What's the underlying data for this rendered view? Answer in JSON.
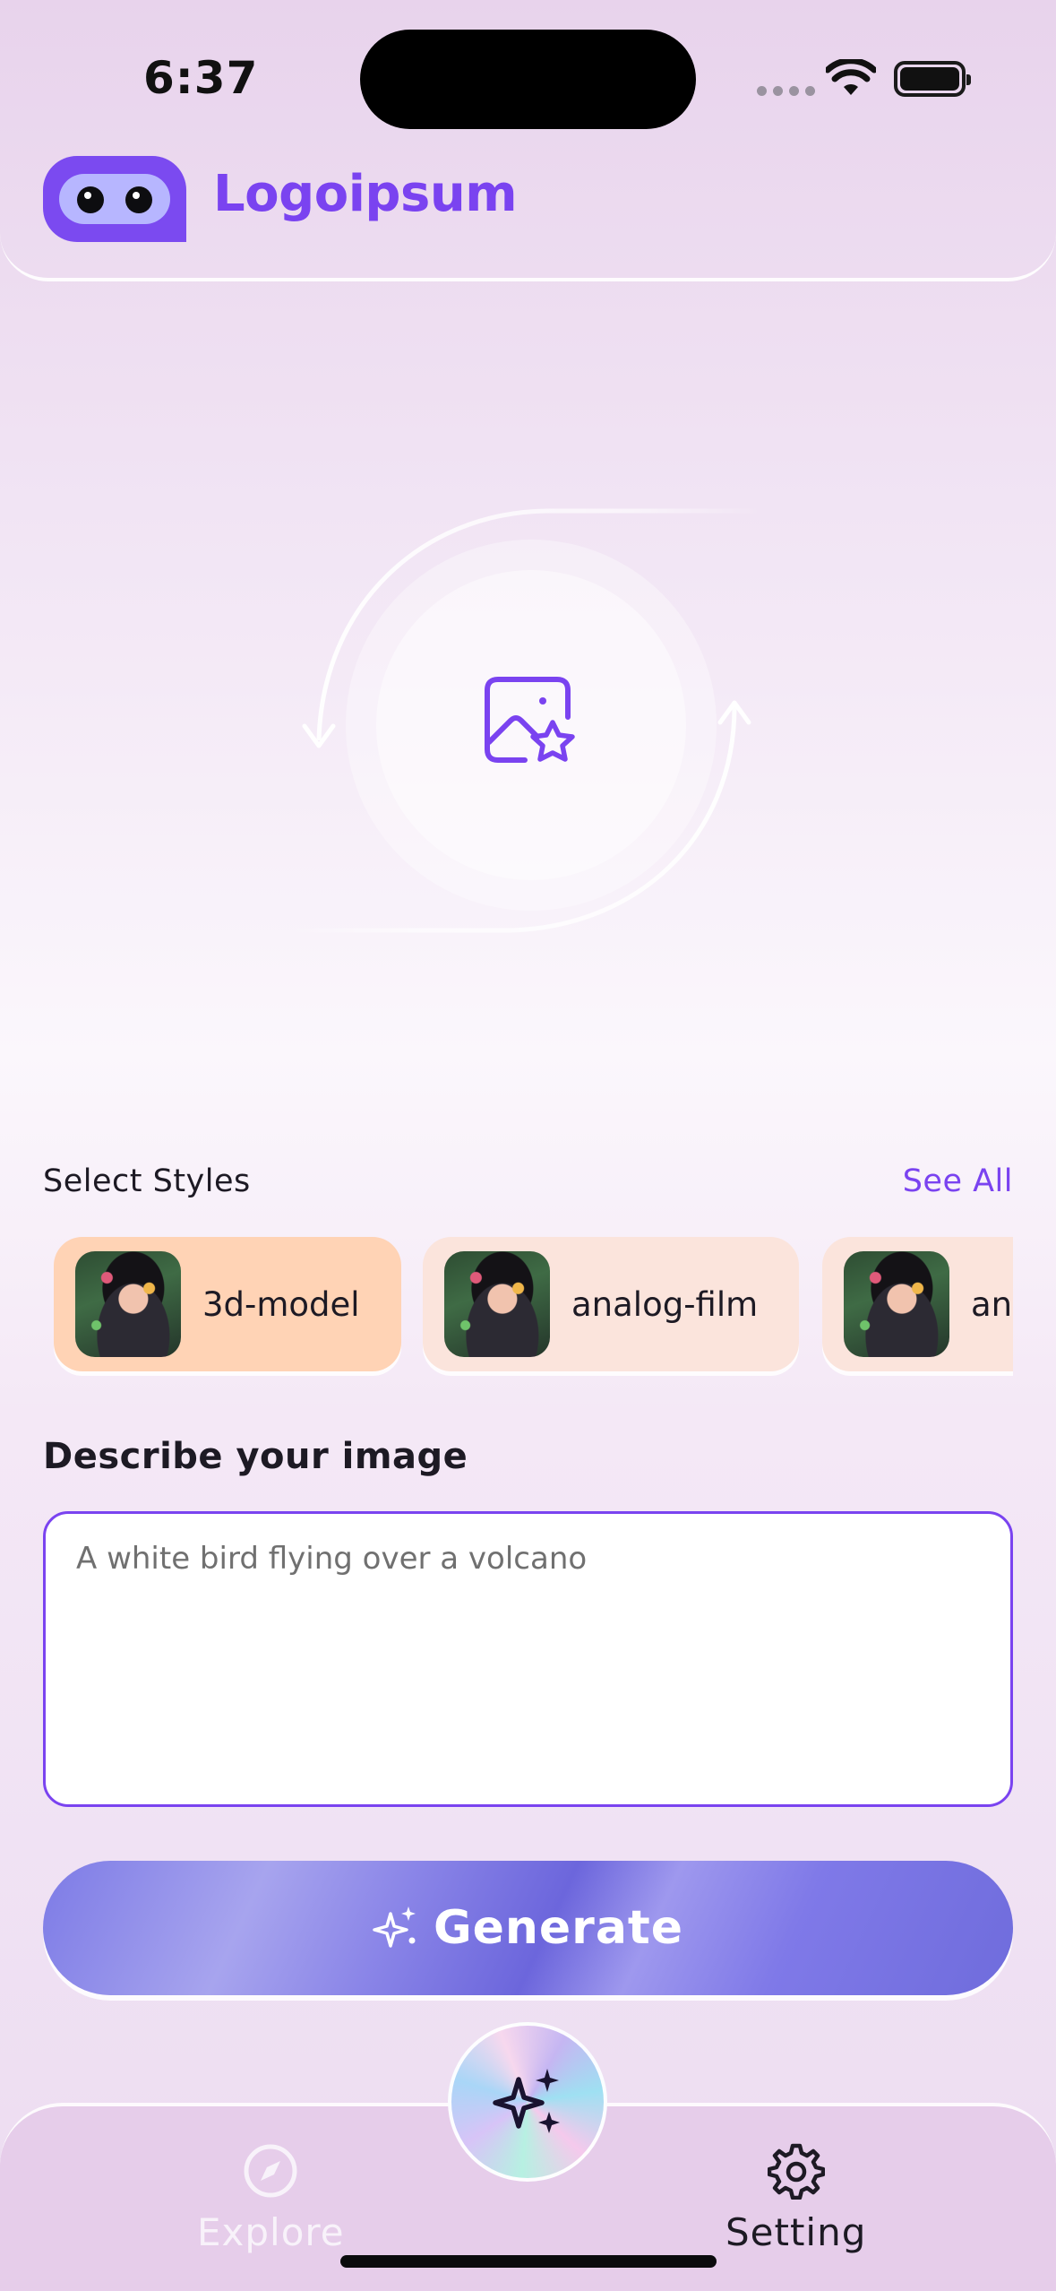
{
  "status_bar": {
    "time": "6:37"
  },
  "header": {
    "logo_text": "Logoipsum"
  },
  "styles": {
    "title": "Select Styles",
    "see_all": "See All",
    "items": [
      {
        "label": "3d-model",
        "selected": true
      },
      {
        "label": "analog-film",
        "selected": false
      },
      {
        "label": "an",
        "selected": false
      }
    ]
  },
  "describe": {
    "title": "Describe your image",
    "placeholder": "A white bird flying over a volcano"
  },
  "generate": {
    "label": "Generate"
  },
  "nav": {
    "explore_label": "Explore",
    "setting_label": "Setting"
  },
  "colors": {
    "accent": "#7a43f0",
    "chip_selected": "#ffd3b5",
    "chip_default": "#fbe4dc",
    "nav_bg": "#e6cdea"
  },
  "icons": {
    "hero": "image-star-icon",
    "generate": "sparkles-icon",
    "explore": "compass-icon",
    "setting": "gear-icon",
    "fab": "sparkles-icon"
  }
}
